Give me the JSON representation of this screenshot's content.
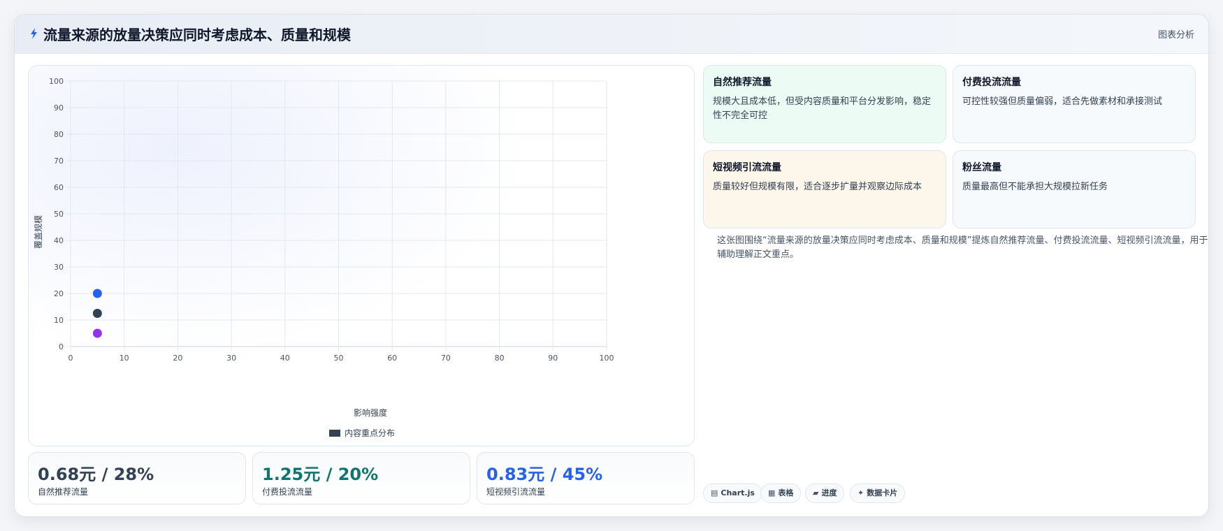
{
  "header": {
    "title": "流量来源的放量决策应同时考虑成本、质量和规模",
    "label": "图表分析"
  },
  "chart_data": {
    "type": "scatter",
    "xlabel": "影响强度",
    "ylabel": "覆盖规模",
    "xlim": [
      0,
      100
    ],
    "ylim": [
      0,
      100
    ],
    "xticks": [
      0,
      10,
      20,
      30,
      40,
      50,
      60,
      70,
      80,
      90,
      100
    ],
    "yticks": [
      0,
      10,
      20,
      30,
      40,
      50,
      60,
      70,
      80,
      90,
      100
    ],
    "grid": true,
    "legend": {
      "label": "内容重点分布",
      "position": "bottom",
      "color": "#334155"
    },
    "points": [
      {
        "x": 5,
        "y": 20,
        "color": "#2563eb"
      },
      {
        "x": 5,
        "y": 12.5,
        "color": "#334155"
      },
      {
        "x": 5,
        "y": 5,
        "color": "#9333ea"
      }
    ]
  },
  "stats": [
    {
      "value": "0.68元 / 28%",
      "label": "自然推荐流量",
      "color": "#334155"
    },
    {
      "value": "1.25元 / 20%",
      "label": "付费投流流量",
      "color": "#0f766e"
    },
    {
      "value": "0.83元 / 45%",
      "label": "短视频引流流量",
      "color": "#2563eb"
    }
  ],
  "cards": [
    {
      "title": "自然推荐流量",
      "desc": "规模大且成本低，但受内容质量和平台分发影响，稳定性不完全可控",
      "bg": "#ecfbf3"
    },
    {
      "title": "付费投流流量",
      "desc": "可控性较强但质量偏弱，适合先做素材和承接测试",
      "bg": "#f7fafc"
    },
    {
      "title": "短视频引流流量",
      "desc": "质量较好但规模有限，适合逐步扩量并观察边际成本",
      "bg": "#fdf6ea"
    },
    {
      "title": "粉丝流量",
      "desc": "质量最高但不能承担大规模拉新任务",
      "bg": "#f7fafc"
    }
  ],
  "description": "这张图围绕“流量来源的放量决策应同时考虑成本、质量和规模”提炼自然推荐流量、付费投流流量、短视频引流流量，用于辅助理解正文重点。",
  "tags": [
    {
      "icon": "▤",
      "label": "Chart.js"
    },
    {
      "icon": "▦",
      "label": "表格"
    },
    {
      "icon": "▰",
      "label": "进度"
    },
    {
      "icon": "✦",
      "label": "数据卡片"
    }
  ],
  "colors": {
    "accent": "#2563eb",
    "grid": "#e2e8f0"
  },
  "icons": {
    "title": "lightning-icon"
  }
}
